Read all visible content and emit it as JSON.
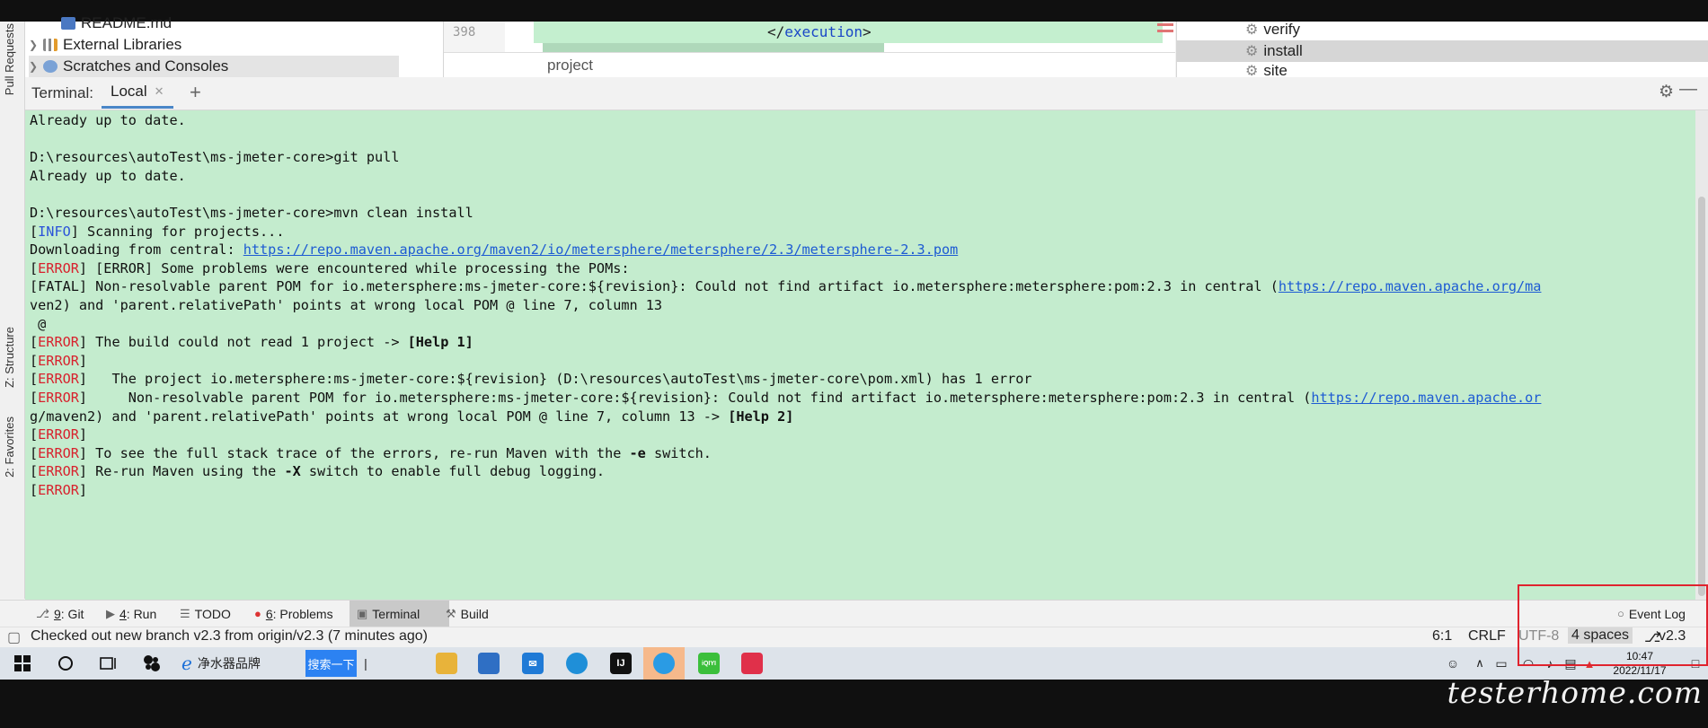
{
  "window": {
    "watermark": "testerhome.com"
  },
  "left_stripe": {
    "items": [
      "Pull Requests",
      "Z: Structure",
      "2: Favorites"
    ]
  },
  "project_tree": [
    {
      "label": "README.md",
      "icon": "markdown-file-icon",
      "expandable": false
    },
    {
      "label": "External Libraries",
      "icon": "library-icon",
      "expandable": true
    },
    {
      "label": "Scratches and Consoles",
      "icon": "scratches-icon",
      "expandable": true
    }
  ],
  "editor": {
    "line_number": "398",
    "code": {
      "open": "</",
      "tag": "execution",
      "close": ">"
    },
    "breadcrumb": "project"
  },
  "maven": {
    "items": [
      "verify",
      "install",
      "site"
    ],
    "selected": "install"
  },
  "terminal": {
    "header_label": "Terminal:",
    "tab_label": "Local",
    "lines": [
      [
        {
          "t": "Already up to date."
        }
      ],
      [
        {
          "t": ""
        }
      ],
      [
        {
          "t": "D:\\resources\\autoTest\\ms-jmeter-core>git pull"
        }
      ],
      [
        {
          "t": "Already up to date."
        }
      ],
      [
        {
          "t": ""
        }
      ],
      [
        {
          "t": "D:\\resources\\autoTest\\ms-jmeter-core>mvn clean install"
        }
      ],
      [
        {
          "t": "["
        },
        {
          "t": "INFO",
          "c": "info"
        },
        {
          "t": "] Scanning for projects..."
        }
      ],
      [
        {
          "t": "Downloading from central: "
        },
        {
          "t": "https://repo.maven.apache.org/maven2/io/metersphere/metersphere/2.3/metersphere-2.3.pom",
          "c": "link"
        }
      ],
      [
        {
          "t": "["
        },
        {
          "t": "ERROR",
          "c": "error"
        },
        {
          "t": "] [ERROR] Some problems were encountered while processing the POMs:"
        }
      ],
      [
        {
          "t": "[FATAL] Non-resolvable parent POM for io.metersphere:ms-jmeter-core:${revision}: Could not find artifact io.metersphere:metersphere:pom:2.3 in central ("
        },
        {
          "t": "https://repo.maven.apache.org/ma",
          "c": "link"
        }
      ],
      [
        {
          "t": "ven2) and 'parent.relativePath' points at wrong local POM @ line 7, column 13"
        }
      ],
      [
        {
          "t": " @"
        }
      ],
      [
        {
          "t": "["
        },
        {
          "t": "ERROR",
          "c": "error"
        },
        {
          "t": "] The build could not read 1 project -> "
        },
        {
          "t": "[Help 1]",
          "c": "bold"
        }
      ],
      [
        {
          "t": "["
        },
        {
          "t": "ERROR",
          "c": "error"
        },
        {
          "t": "]"
        }
      ],
      [
        {
          "t": "["
        },
        {
          "t": "ERROR",
          "c": "error"
        },
        {
          "t": "]   The project io.metersphere:ms-jmeter-core:${revision} (D:\\resources\\autoTest\\ms-jmeter-core\\pom.xml) has 1 error"
        }
      ],
      [
        {
          "t": "["
        },
        {
          "t": "ERROR",
          "c": "error"
        },
        {
          "t": "]     Non-resolvable parent POM for io.metersphere:ms-jmeter-core:${revision}: Could not find artifact io.metersphere:metersphere:pom:2.3 in central ("
        },
        {
          "t": "https://repo.maven.apache.or",
          "c": "link"
        }
      ],
      [
        {
          "t": "g/maven2) and 'parent.relativePath' points at wrong local POM @ line 7, column 13 -> "
        },
        {
          "t": "[Help 2]",
          "c": "bold"
        }
      ],
      [
        {
          "t": "["
        },
        {
          "t": "ERROR",
          "c": "error"
        },
        {
          "t": "]"
        }
      ],
      [
        {
          "t": "["
        },
        {
          "t": "ERROR",
          "c": "error"
        },
        {
          "t": "] To see the full stack trace of the errors, re-run Maven with the "
        },
        {
          "t": "-e",
          "c": "bold"
        },
        {
          "t": " switch."
        }
      ],
      [
        {
          "t": "["
        },
        {
          "t": "ERROR",
          "c": "error"
        },
        {
          "t": "] Re-run Maven using the "
        },
        {
          "t": "-X",
          "c": "bold"
        },
        {
          "t": " switch to enable full debug logging."
        }
      ],
      [
        {
          "t": "["
        },
        {
          "t": "ERROR",
          "c": "error"
        },
        {
          "t": "]"
        }
      ]
    ]
  },
  "tool_windows": {
    "git": {
      "num": "9",
      "label": ": Git"
    },
    "run": {
      "num": "4",
      "label": ": Run"
    },
    "todo": {
      "label": "TODO"
    },
    "problems": {
      "num": "6",
      "label": ": Problems"
    },
    "terminal": {
      "label": "Terminal"
    },
    "build": {
      "label": "Build"
    },
    "event_log": {
      "label": "Event Log"
    }
  },
  "status_bar": {
    "message": "Checked out new branch v2.3 from origin/v2.3 (7 minutes ago)",
    "position": "6:1",
    "line_sep": "CRLF",
    "encoding": "UTF-8",
    "indent": "4 spaces",
    "branch": "v2.3"
  },
  "taskbar": {
    "search_text": "净水器品牌",
    "search_button": "搜索一下",
    "apps": [
      "file-explorer",
      "store",
      "mail",
      "edge",
      "intellij",
      "qq-browser",
      "iqiyi",
      "pdf-reader"
    ],
    "iqiyi_label": "iQIYI",
    "time": "10:47",
    "date": "2022/11/17"
  },
  "colors": {
    "terminal_bg": "#c4ecce",
    "error": "#d8212d",
    "info": "#2a52d9",
    "link": "#1d5bd3",
    "highlight_box": "#e0232e"
  }
}
